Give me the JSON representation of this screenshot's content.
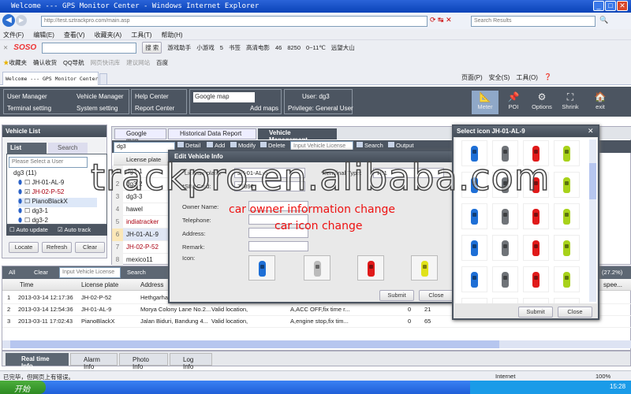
{
  "browser": {
    "title": "Welcome --- GPS Monitor Center - Windows Internet Explorer",
    "url": "http://test.sztrackpro.com/main.asp",
    "search_placeholder": "Search Results",
    "menu": [
      "文件(F)",
      "编辑(E)",
      "查看(V)",
      "收藏夹(A)",
      "工具(T)",
      "帮助(H)"
    ],
    "soso": {
      "logo": "SOSO",
      "search_btn": "搜 索",
      "items": [
        "游戏助手",
        "小游戏",
        "5",
        "书签",
        "高清电影",
        "46",
        "8250",
        "0~11℃",
        "远望大山"
      ]
    },
    "favorites": [
      "收藏夹",
      "确认收货",
      "QQ导航",
      "网页快讯库",
      "建议网站",
      "百度"
    ],
    "tab": "Welcome --- GPS Monitor Center",
    "cmdbar": [
      "页面(P)",
      "安全(S)",
      "工具(O)"
    ],
    "status": "已完毕，但网页上有错误。",
    "zone": "Internet",
    "zoom": "100%"
  },
  "app": {
    "menu": {
      "user_manager": "User Manager",
      "vehicle_manager": "Vehicle Manager",
      "terminal_setting": "Terminal setting",
      "system_setting": "System setting",
      "help_center": "Help Center",
      "report_center": "Report Center",
      "map_select": "Google map",
      "add_maps": "Add maps",
      "user": "User: dg3",
      "privilege": "Privilege: General User"
    },
    "tools": [
      "Meter",
      "POI",
      "Options",
      "Shrink",
      "exit"
    ]
  },
  "vehicle_list": {
    "title": "Vehicle List",
    "tab_list": "List",
    "tab_search": "Search",
    "user_placeholder": "Please Select a User",
    "root": "dg3 (11)",
    "items": [
      {
        "name": "JH-01-AL-9",
        "checked": false
      },
      {
        "name": "JH-02-P-52",
        "checked": true
      },
      {
        "name": "PianoBlackX",
        "checked": false
      },
      {
        "name": "dg3-1",
        "checked": false
      },
      {
        "name": "dg3-2",
        "checked": false
      }
    ],
    "auto_update": "Auto update",
    "auto_track": "Auto track",
    "locate": "Locate",
    "refresh": "Refresh",
    "clear": "Clear"
  },
  "main_tabs": [
    "Google map",
    "Historical Data Report",
    "Vehicle Management"
  ],
  "vm": {
    "user": "dg3",
    "toolbar": [
      "Detail",
      "Add",
      "Modify",
      "Delete"
    ],
    "search_placeholder": "Input Vehicle License",
    "search": "Search",
    "output": "Output",
    "col": "License plate",
    "rows": [
      "dg3-1",
      "dg3-2",
      "dg3-3",
      "hawel",
      "indiatracker",
      "JH-01-AL-9",
      "JH-02-P-52",
      "mexico11"
    ]
  },
  "edit": {
    "title": "Edit Vehicle Info",
    "license_label": "*License plate:",
    "license": "JH-01-AL-9",
    "terminal_label": "*Terminal Type:",
    "terminal": "TE1",
    "sim_label": "*SIM Card:",
    "sim": "77890",
    "owner": "Owner Name:",
    "tel": "Telephone:",
    "address": "Address:",
    "remark": "Remark:",
    "icon": "Icon:",
    "submit": "Submit",
    "close": "Close"
  },
  "annotation": [
    "car owner information change",
    "car icon change"
  ],
  "watermark": "trackpro.en.alibaba.com",
  "select_icon": {
    "title": "Select icon JH-01-AL-9",
    "submit": "Submit",
    "close": "Close",
    "colors": [
      "#1e6fd6",
      "#6f7378",
      "#e01a1a",
      "#a8d21a"
    ]
  },
  "realtime": {
    "all": "All",
    "clear": "Clear",
    "search_placeholder": "Input Vehicle License",
    "search": "Search",
    "percent": "(27.2%)",
    "speed_col": "spee...",
    "cols": [
      "Time",
      "License plate",
      "Address"
    ],
    "rows": [
      [
        "1",
        "2013-03-14 12:17:36",
        "JH-02-P-52",
        "Hethgarha Fixer Link Pe...",
        "Valid location,",
        "A,ACC OFF,fix time r...",
        "0",
        ""
      ],
      [
        "2",
        "2013-03-14 12:54:36",
        "JH-01-AL-9",
        "Morya Colony Lane No.2...",
        "Valid location,",
        "A,ACC OFF,fix time r...",
        "0",
        "21"
      ],
      [
        "3",
        "2013-03-11 17:02:43",
        "PianoBlackX",
        "Jalan Biduri, Bandung 4...",
        "Valid location,",
        "A,engine stop,fix tim...",
        "0",
        "65"
      ]
    ]
  },
  "bottom_tabs": [
    "Real time Info",
    "Alarm Info",
    "Photo Info",
    "Log Info"
  ],
  "taskbar": {
    "start": "开始",
    "clock": "15:28"
  }
}
